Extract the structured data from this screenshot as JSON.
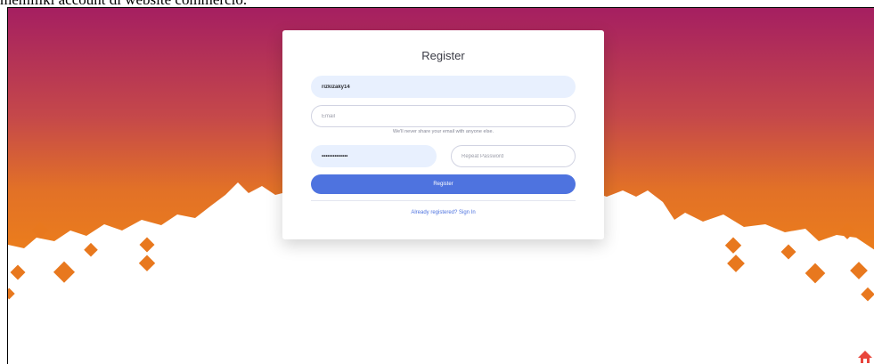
{
  "caption": "memiliki account di website commercio.",
  "register_form": {
    "title": "Register",
    "username_value": "rizkizaky14",
    "email_placeholder": "Email",
    "email_help": "We'll never share your email with anyone else.",
    "password_value": "••••••••••••••",
    "repeat_password_placeholder": "Repeat Password",
    "submit_label": "Register",
    "signin_link": "Already registered? Sign In"
  },
  "colors": {
    "gradient_top": "#a51f61",
    "gradient_bottom": "#e8781e",
    "accent": "#4e73df"
  },
  "icons": {
    "corner": "house-icon"
  }
}
